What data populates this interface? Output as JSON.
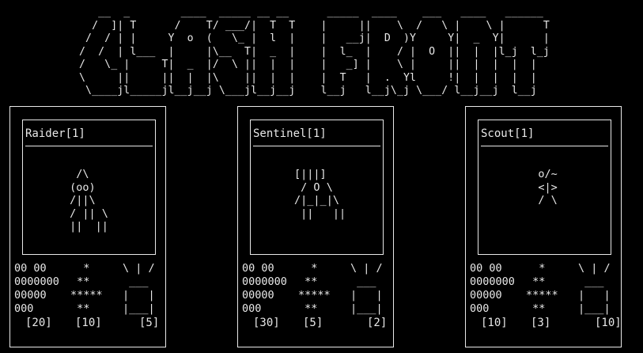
{
  "title_banner": [
    "   __  _        ____  _____ __ __      _____  ____    ___   ____   ______ ",
    "  /  ]| T      /    T/ ___/|  T  T    |     ||    \\  /   \\ |    \\ |      T",
    " /  / | |     Y  o  (   \\_ |  l  |    |   __j|  D  )Y     Y|  _  Y|      |",
    "/  /  | l___  |     |\\__  T|  _  |    |  l_  |    / |  O  ||  |  |l_j  l_j",
    "/   \\_ |     T|  _  |/  \\ ||  |  |    |   _] |    \\ |     ||  |  |  |  |  ",
    "\\     ||     ||  |  |\\    ||  |  |    |  T   |  .  Yl     !|  |  |  |  |  ",
    " \\____jl_____jl__j__j \\___jl__j__j    l__j   l__j\\_j \\___/ l__j__j  l__j  "
  ],
  "cards": [
    {
      "name": "Raider[1]",
      "art": [
        " /\\",
        "(oo)",
        "/||\\",
        "/ || \\",
        "||  ||"
      ],
      "hp_icon": [
        "00 00",
        "0000000",
        "00000",
        "000"
      ],
      "atk_icon": [
        "  *",
        " **",
        "*****",
        " **"
      ],
      "shield_icon": [
        "\\ | /",
        " ___ ",
        "|   |",
        "|___|"
      ],
      "hp": "[20]",
      "atk": "[10]",
      "shield": "[5]"
    },
    {
      "name": "Sentinel[1]",
      "art": [
        " [|||]",
        "  / O \\",
        " /|_|_|\\",
        "  ||   ||"
      ],
      "hp_icon": [
        "00 00",
        "0000000",
        "00000",
        "000"
      ],
      "atk_icon": [
        "  *",
        " **",
        "*****",
        " **"
      ],
      "shield_icon": [
        "\\ | /",
        " ___ ",
        "|   |",
        "|___|"
      ],
      "hp": "[30]",
      "atk": "[5]",
      "shield": "[2]"
    },
    {
      "name": "Scout[1]",
      "art": [
        " o/~",
        " <|>",
        " / \\"
      ],
      "hp_icon": [
        "00 00",
        "0000000",
        "00000",
        "000"
      ],
      "atk_icon": [
        "  *",
        " **",
        "*****",
        " **"
      ],
      "shield_icon": [
        "\\ | /",
        " ___ ",
        "|   |",
        "|___|"
      ],
      "hp": "[10]",
      "atk": "[3]",
      "shield": "[10]"
    }
  ]
}
